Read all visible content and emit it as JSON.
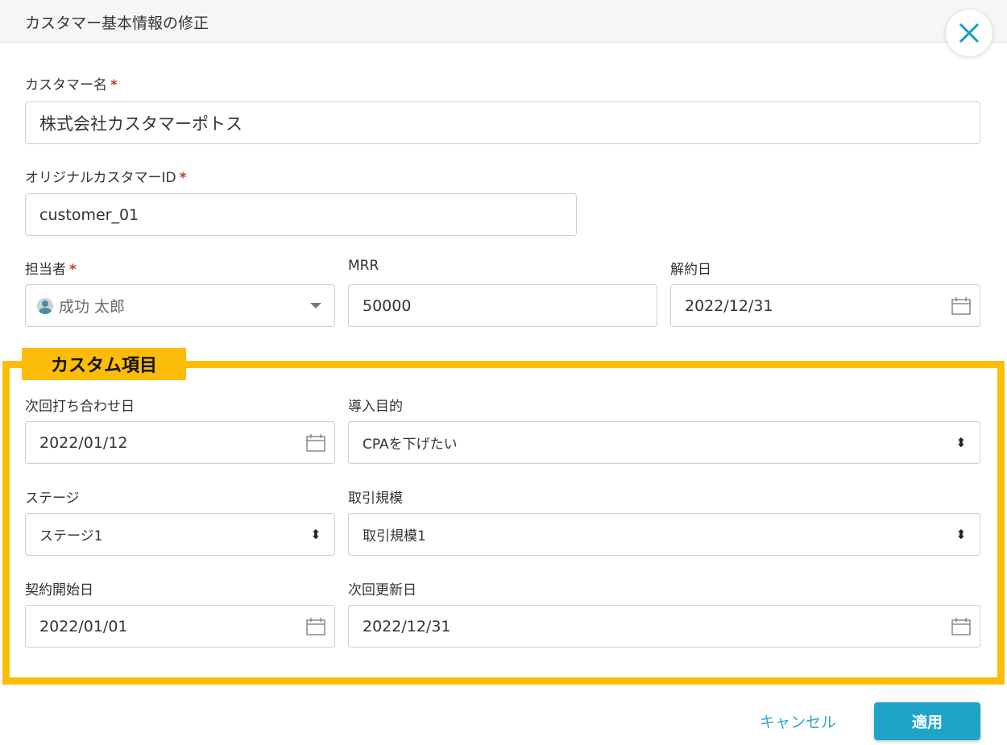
{
  "header": {
    "title": "カスタマー基本情報の修正"
  },
  "fields": {
    "customer_name": {
      "label": "カスタマー名",
      "required": "*",
      "value": "株式会社カスタマーポトス"
    },
    "original_id": {
      "label": "オリジナルカスタマーID",
      "required": "*",
      "value": "customer_01"
    },
    "owner": {
      "label": "担当者",
      "required": "*",
      "value": "成功 太郎"
    },
    "mrr": {
      "label": "MRR",
      "value": "50000"
    },
    "cancel_date": {
      "label": "解約日",
      "value": "2022/12/31"
    }
  },
  "custom": {
    "title": "カスタム項目",
    "next_meeting": {
      "label": "次回打ち合わせ日",
      "value": "2022/01/12"
    },
    "purpose": {
      "label": "導入目的",
      "value": "CPAを下げたい"
    },
    "stage": {
      "label": "ステージ",
      "value": "ステージ1"
    },
    "deal_size": {
      "label": "取引規模",
      "value": "取引規模1"
    },
    "contract_start": {
      "label": "契約開始日",
      "value": "2022/01/01"
    },
    "next_renewal": {
      "label": "次回更新日",
      "value": "2022/12/31"
    }
  },
  "actions": {
    "cancel": "キャンセル",
    "apply": "適用"
  },
  "icons": {
    "close": "close-icon",
    "calendar": "calendar-icon",
    "dropdown": "caret-down-icon",
    "select": "sort-updown-icon",
    "avatar": "user-avatar-icon"
  },
  "colors": {
    "accent": "#1ea4c8",
    "highlight": "#fbbd08",
    "required": "#c0392b",
    "close_icon": "#1a9cc0"
  }
}
